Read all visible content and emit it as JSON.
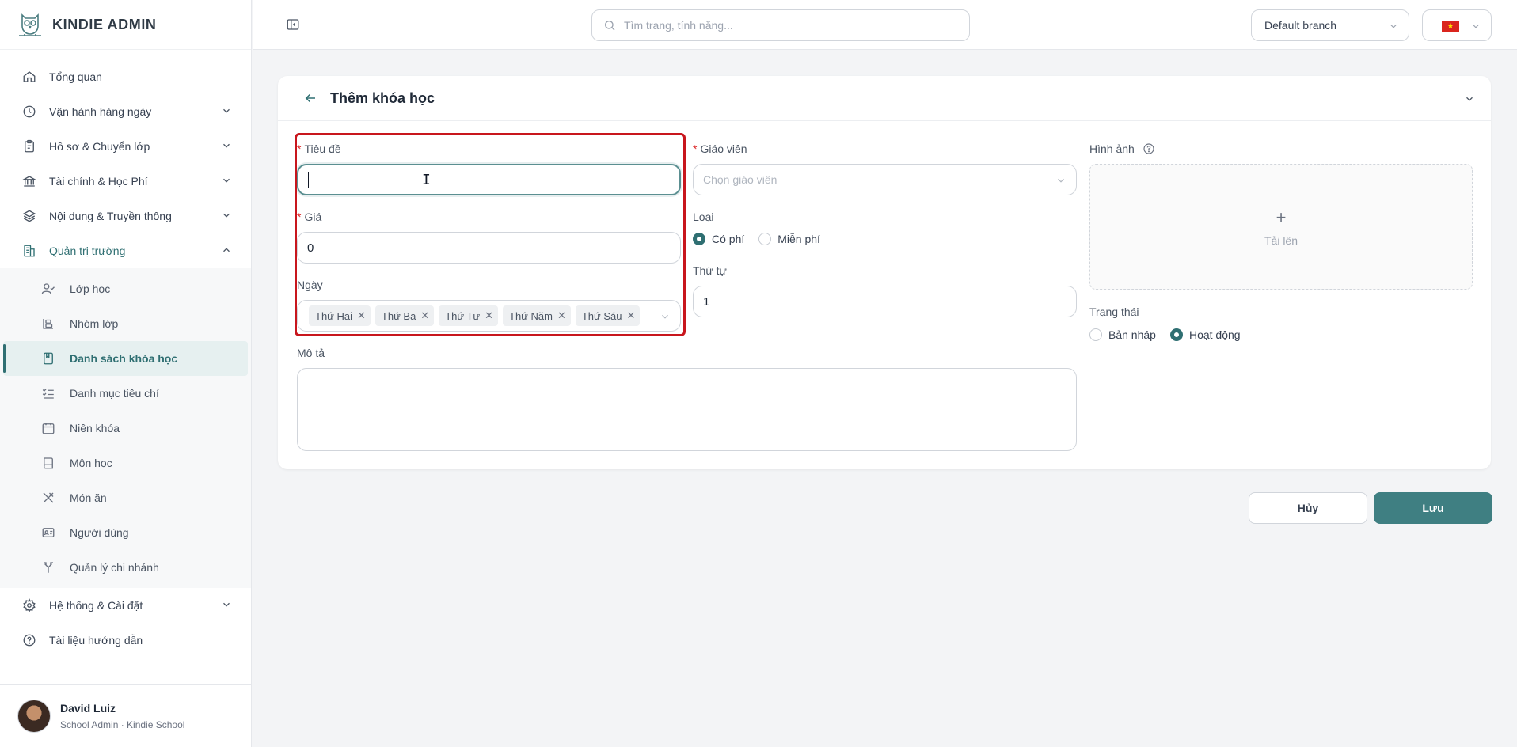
{
  "app": {
    "brand": "KINDIE ADMIN"
  },
  "sidebar": {
    "items": [
      {
        "label": "Tổng quan",
        "icon": "home-icon"
      },
      {
        "label": "Vận hành hàng ngày",
        "icon": "clock-icon"
      },
      {
        "label": "Hồ sơ & Chuyển lớp",
        "icon": "clipboard-icon"
      },
      {
        "label": "Tài chính & Học Phí",
        "icon": "bank-icon"
      },
      {
        "label": "Nội dung & Truyền thông",
        "icon": "layers-icon"
      },
      {
        "label": "Quản trị trường",
        "icon": "building-icon"
      }
    ],
    "subitems": [
      {
        "label": "Lớp học",
        "icon": "user-check-icon"
      },
      {
        "label": "Nhóm lớp",
        "icon": "group-icon"
      },
      {
        "label": "Danh sách khóa học",
        "icon": "bookmark-icon"
      },
      {
        "label": "Danh mục tiêu chí",
        "icon": "list-check-icon"
      },
      {
        "label": "Niên khóa",
        "icon": "calendar-icon"
      },
      {
        "label": "Môn học",
        "icon": "book-icon"
      },
      {
        "label": "Món ăn",
        "icon": "utensils-icon"
      },
      {
        "label": "Người dùng",
        "icon": "id-card-icon"
      },
      {
        "label": "Quản lý chi nhánh",
        "icon": "branch-icon"
      }
    ],
    "bottom_items": [
      {
        "label": "Hệ thống & Cài đặt",
        "icon": "gear-icon"
      },
      {
        "label": "Tài liệu hướng dẫn",
        "icon": "help-circle-icon"
      }
    ],
    "user": {
      "name": "David Luiz",
      "role": "School Admin · Kindie School"
    }
  },
  "topbar": {
    "search_placeholder": "Tìm trang, tính năng...",
    "branch": "Default branch"
  },
  "form": {
    "title": "Thêm khóa học",
    "title_label": "Tiêu đề",
    "title_value": "",
    "price_label": "Giá",
    "price_value": "0",
    "days_label": "Ngày",
    "days": [
      "Thứ Hai",
      "Thứ Ba",
      "Thứ Tư",
      "Thứ Năm",
      "Thứ Sáu"
    ],
    "teacher_label": "Giáo viên",
    "teacher_placeholder": "Chọn giáo viên",
    "type_label": "Loại",
    "type_options": [
      "Có phí",
      "Miễn phí"
    ],
    "type_selected": "Có phí",
    "order_label": "Thứ tự",
    "order_value": "1",
    "image_label": "Hình ảnh",
    "upload_label": "Tải lên",
    "status_label": "Trạng thái",
    "status_options": [
      "Bản nháp",
      "Hoạt động"
    ],
    "status_selected": "Hoạt động",
    "description_label": "Mô tả"
  },
  "actions": {
    "cancel": "Hủy",
    "save": "Lưu"
  },
  "colors": {
    "accent": "#2f6f72",
    "highlight": "#c8161d",
    "required": "#dc2626"
  }
}
